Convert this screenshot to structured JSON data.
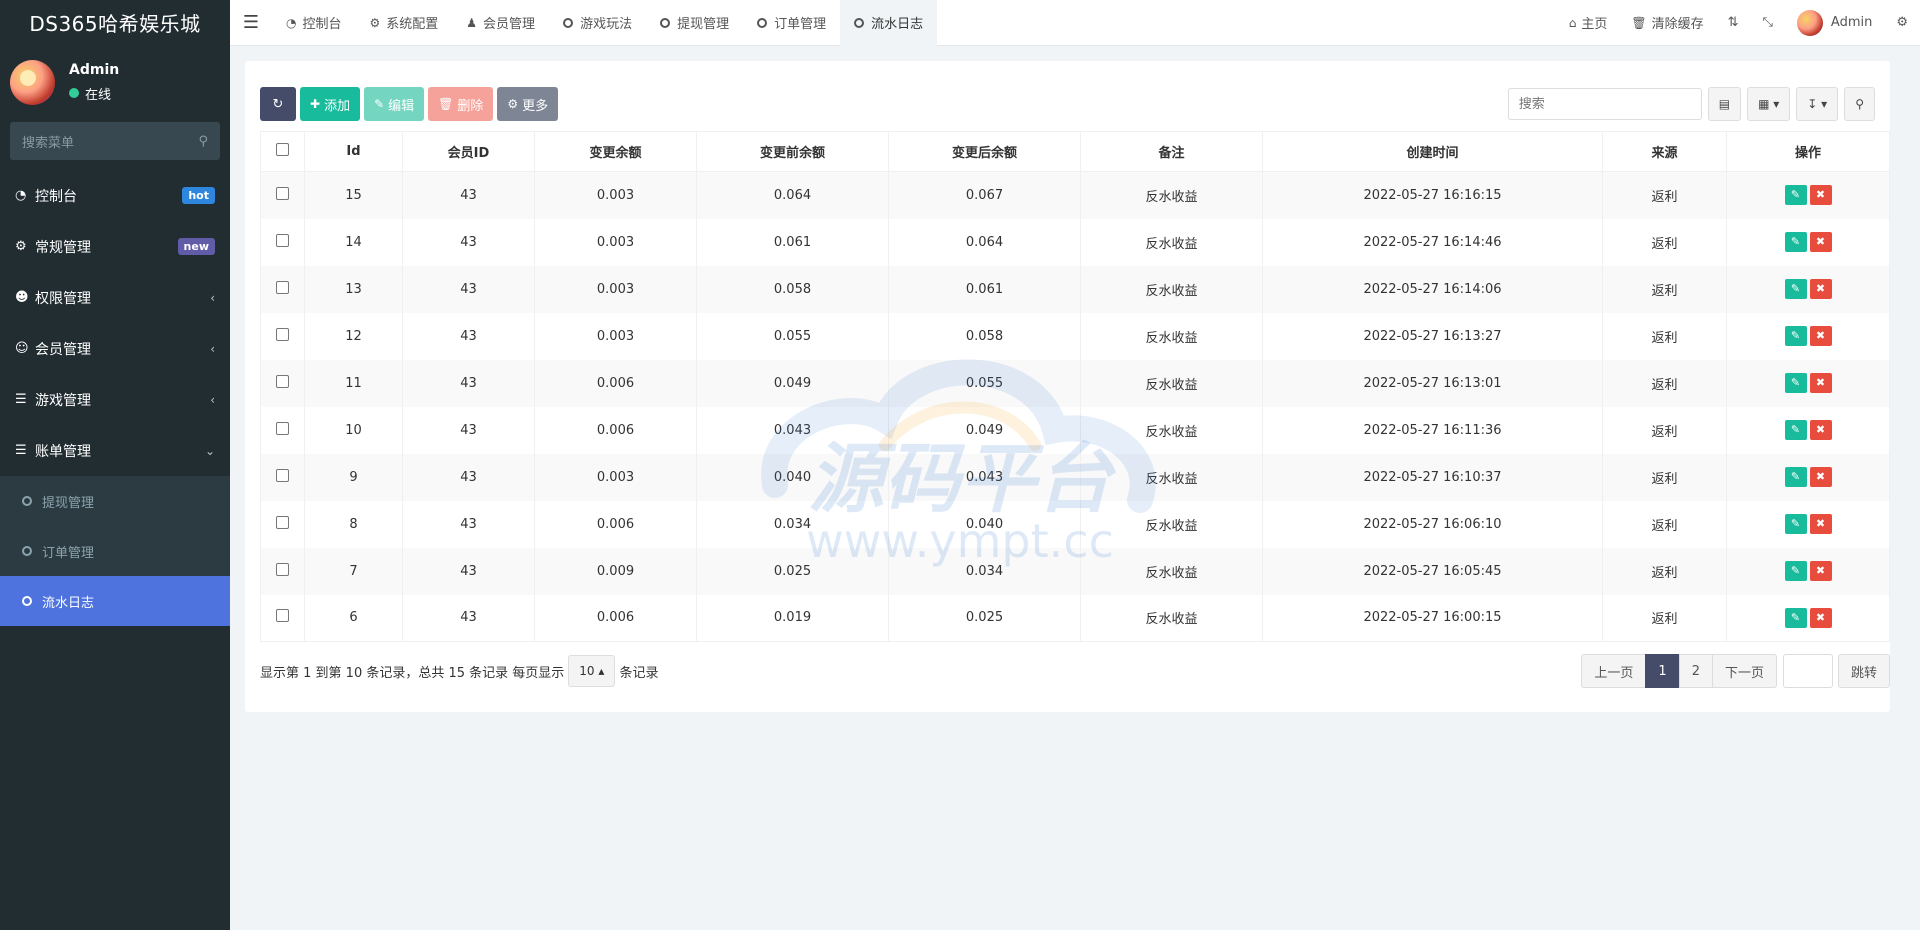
{
  "brand": "DS365哈希娱乐城",
  "user": {
    "name": "Admin",
    "status": "在线"
  },
  "sidebar": {
    "search_placeholder": "搜索菜单",
    "items": [
      {
        "label": "控制台",
        "icon": "dashboard-icon",
        "badge": "hot"
      },
      {
        "label": "常规管理",
        "icon": "cogs-icon",
        "badge": "new"
      },
      {
        "label": "权限管理",
        "icon": "users-icon"
      },
      {
        "label": "会员管理",
        "icon": "user-circle-icon"
      },
      {
        "label": "游戏管理",
        "icon": "list-icon"
      },
      {
        "label": "账单管理",
        "icon": "list-icon"
      }
    ],
    "submenu": [
      "提现管理",
      "订单管理",
      "流水日志"
    ]
  },
  "topbar": {
    "tabs": [
      "控制台",
      "系统配置",
      "会员管理",
      "游戏玩法",
      "提现管理",
      "订单管理",
      "流水日志"
    ],
    "home": "主页",
    "clear_cache": "清除缓存",
    "admin": "Admin"
  },
  "toolbar": {
    "add": "添加",
    "edit": "编辑",
    "delete": "删除",
    "more": "更多",
    "search_placeholder": "搜索"
  },
  "table": {
    "columns": [
      "Id",
      "会员ID",
      "变更余额",
      "变更前余额",
      "变更后余额",
      "备注",
      "创建时间",
      "来源",
      "操作"
    ],
    "rows": [
      [
        "15",
        "43",
        "0.003",
        "0.064",
        "0.067",
        "反水收益",
        "2022-05-27 16:16:15",
        "返利"
      ],
      [
        "14",
        "43",
        "0.003",
        "0.061",
        "0.064",
        "反水收益",
        "2022-05-27 16:14:46",
        "返利"
      ],
      [
        "13",
        "43",
        "0.003",
        "0.058",
        "0.061",
        "反水收益",
        "2022-05-27 16:14:06",
        "返利"
      ],
      [
        "12",
        "43",
        "0.003",
        "0.055",
        "0.058",
        "反水收益",
        "2022-05-27 16:13:27",
        "返利"
      ],
      [
        "11",
        "43",
        "0.006",
        "0.049",
        "0.055",
        "反水收益",
        "2022-05-27 16:13:01",
        "返利"
      ],
      [
        "10",
        "43",
        "0.006",
        "0.043",
        "0.049",
        "反水收益",
        "2022-05-27 16:11:36",
        "返利"
      ],
      [
        "9",
        "43",
        "0.003",
        "0.040",
        "0.043",
        "反水收益",
        "2022-05-27 16:10:37",
        "返利"
      ],
      [
        "8",
        "43",
        "0.006",
        "0.034",
        "0.040",
        "反水收益",
        "2022-05-27 16:06:10",
        "返利"
      ],
      [
        "7",
        "43",
        "0.009",
        "0.025",
        "0.034",
        "反水收益",
        "2022-05-27 16:05:45",
        "返利"
      ],
      [
        "6",
        "43",
        "0.006",
        "0.019",
        "0.025",
        "反水收益",
        "2022-05-27 16:00:15",
        "返利"
      ]
    ]
  },
  "footer": {
    "info_prefix": "显示第 1 到第 10 条记录，总共 15 条记录 每页显示",
    "page_size": "10",
    "info_suffix": "条记录"
  },
  "pager": {
    "prev": "上一页",
    "pages": [
      "1",
      "2"
    ],
    "next": "下一页",
    "jump": "跳转"
  },
  "watermark": {
    "text": "源码平台",
    "url": "www.ympt.cc"
  }
}
